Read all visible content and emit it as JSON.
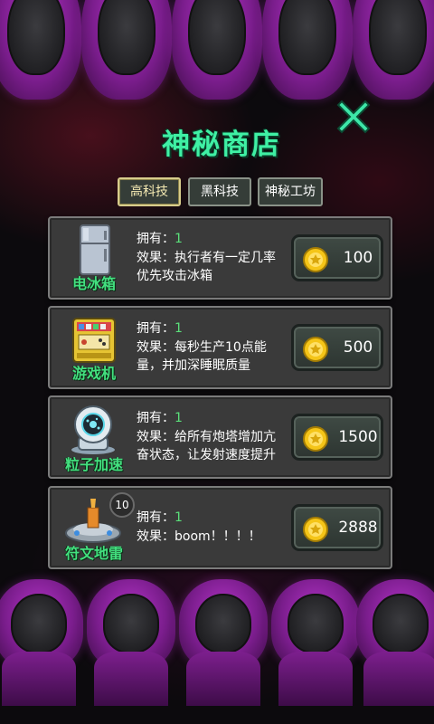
{
  "shop": {
    "title": "神秘商店",
    "close_icon": "close-x-icon"
  },
  "tabs": [
    {
      "label": "高科技",
      "active": true
    },
    {
      "label": "黑科技",
      "active": false
    },
    {
      "label": "神秘工坊",
      "active": false
    }
  ],
  "items": [
    {
      "name": "电冰箱",
      "icon": "fridge-icon",
      "owned_label": "拥有：",
      "owned_value": "1",
      "effect": "效果：执行者有一定几率优先攻击冰箱",
      "price": "100"
    },
    {
      "name": "游戏机",
      "icon": "arcade-machine-icon",
      "owned_label": "拥有：",
      "owned_value": "1",
      "effect": "效果：每秒生产10点能量，并加深睡眠质量",
      "price": "500"
    },
    {
      "name": "粒子加速",
      "icon": "particle-accelerator-icon",
      "owned_label": "拥有：",
      "owned_value": "1",
      "effect": "效果：给所有炮塔增加亢奋状态，让发射速度提升",
      "price": "1500"
    },
    {
      "name": "符文地雷",
      "icon": "rune-mine-icon",
      "owned_label": "拥有：",
      "owned_value": "1",
      "effect": "效果：boom！！！！",
      "price": "2888",
      "badge": "10"
    }
  ],
  "colors": {
    "accent_green": "#3ff0a4",
    "name_green": "#43e07f",
    "coin_gold": "#f5c518",
    "silhouette_purple": "#b434c8"
  }
}
